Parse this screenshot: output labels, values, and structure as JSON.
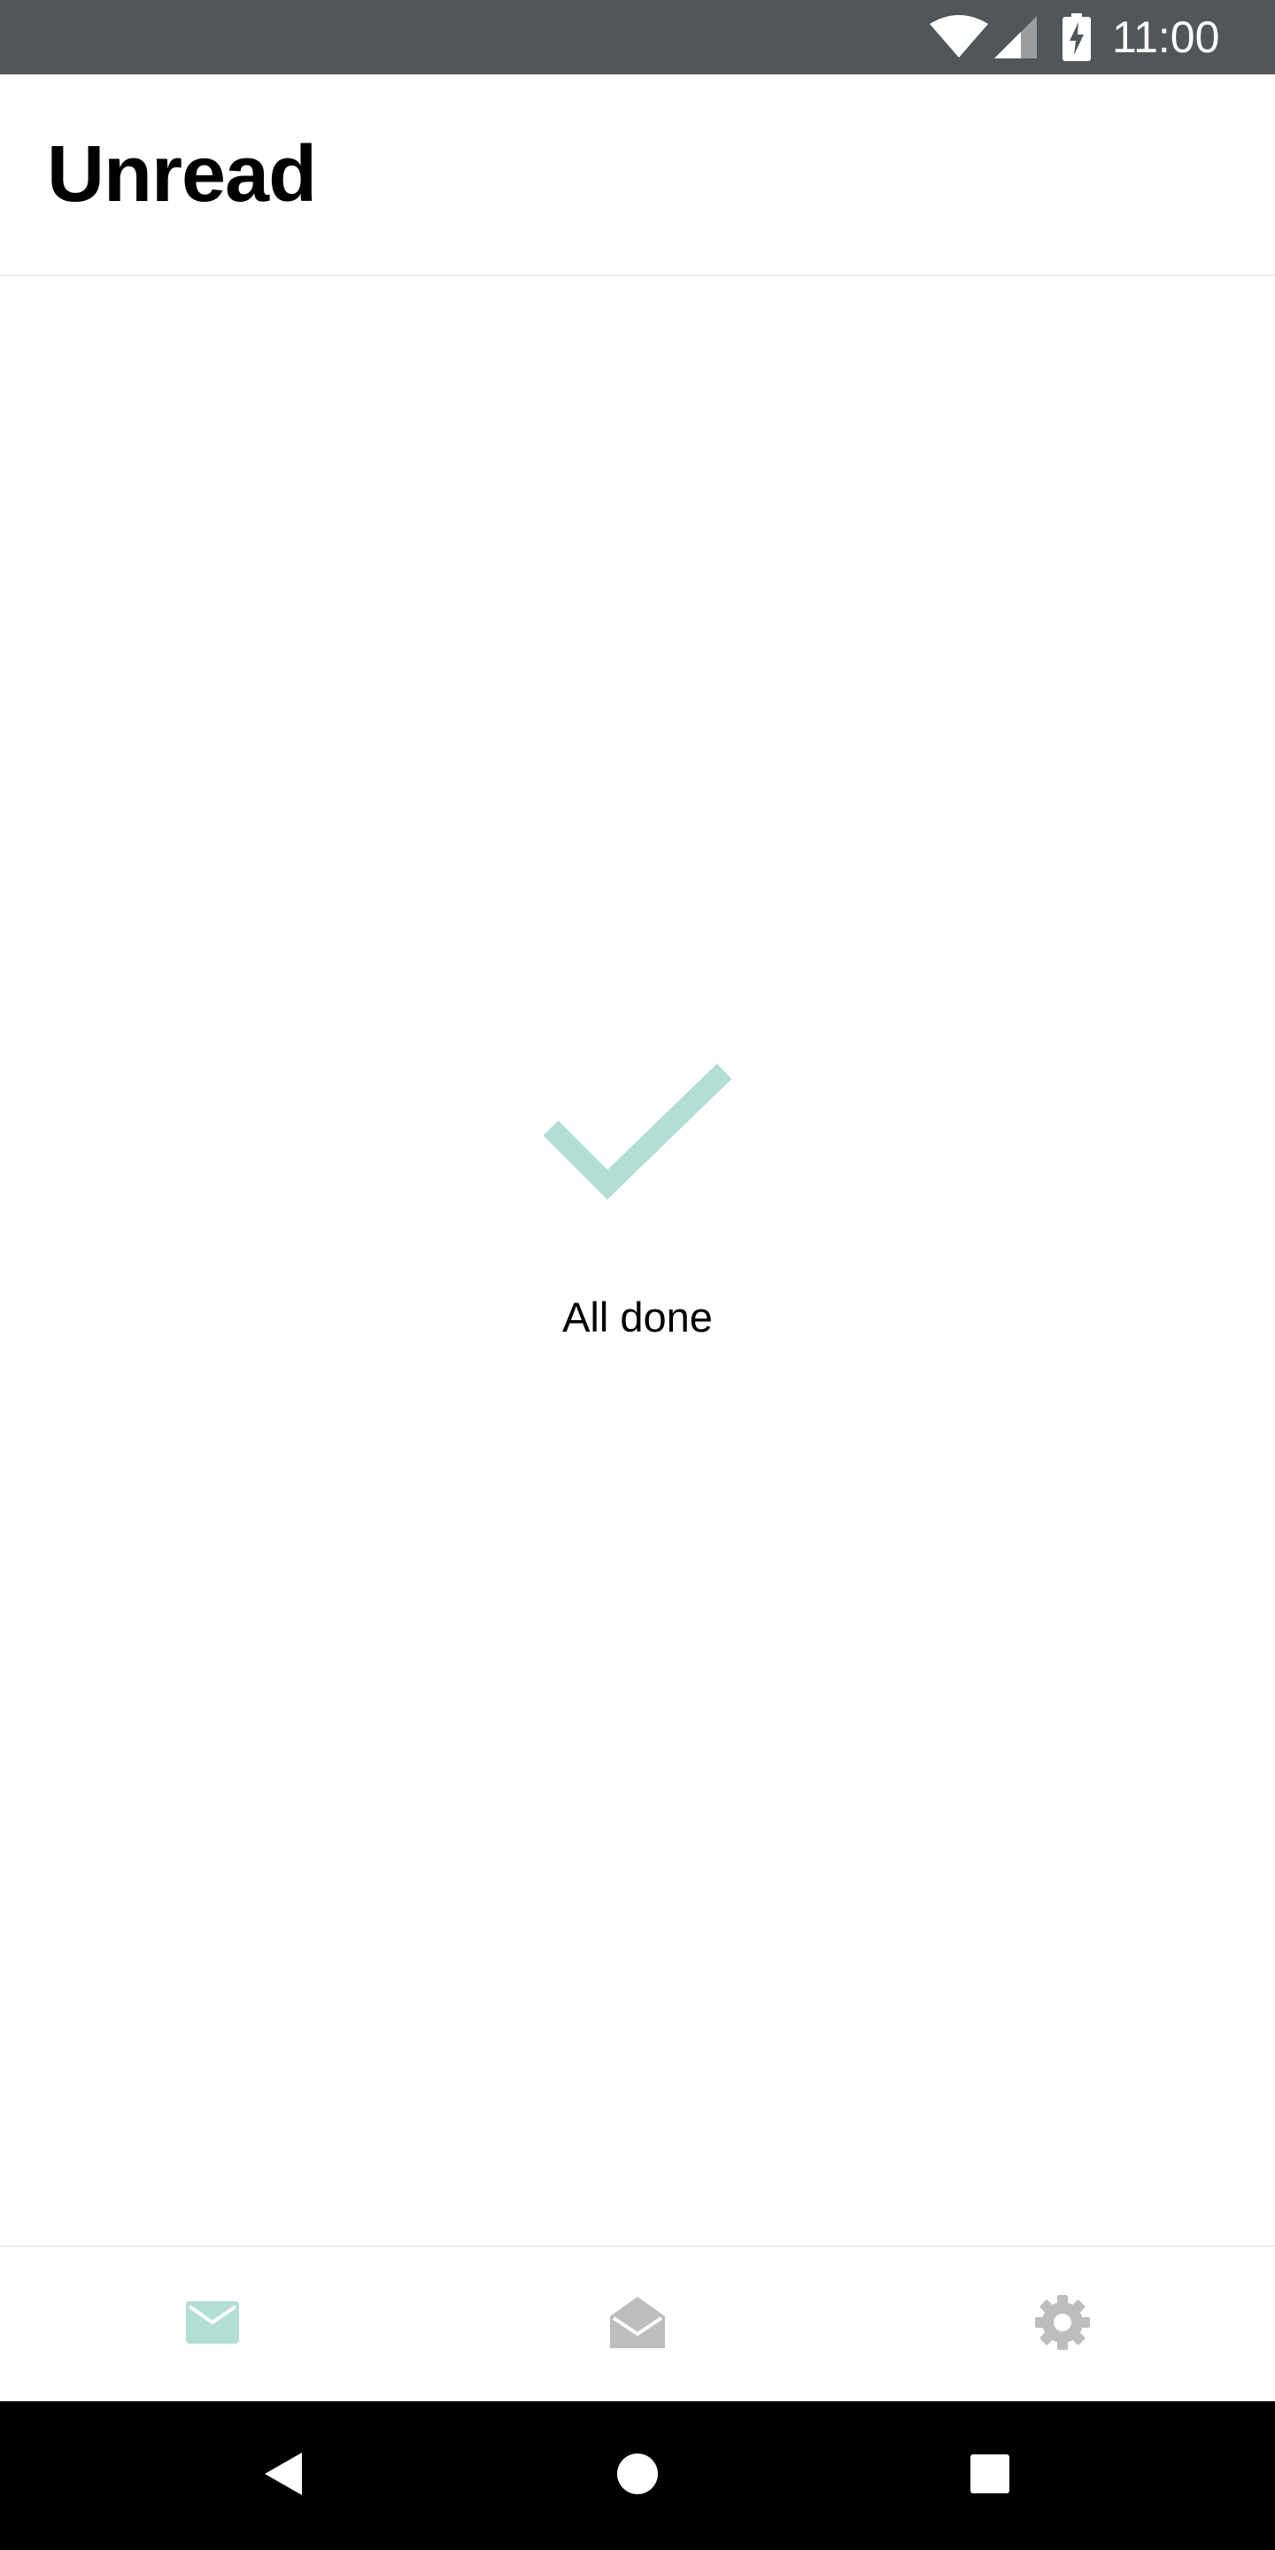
{
  "status_bar": {
    "time": "11:00",
    "icons": [
      "wifi-icon",
      "cellular-signal-icon",
      "battery-charging-icon"
    ]
  },
  "header": {
    "title": "Unread"
  },
  "empty_state": {
    "icon": "checkmark-icon",
    "message": "All done"
  },
  "bottom_nav": {
    "items": [
      {
        "icon": "mail-icon",
        "active": true
      },
      {
        "icon": "mail-open-icon",
        "active": false
      },
      {
        "icon": "settings-gear-icon",
        "active": false
      }
    ]
  },
  "system_nav": {
    "buttons": [
      "back-icon",
      "home-icon",
      "recents-icon"
    ]
  },
  "colors": {
    "status_bar_bg": "#525659",
    "accent": "#b2ded6",
    "inactive_icon": "#bdbdbd",
    "system_nav_bg": "#000000",
    "divider": "#ececec"
  }
}
